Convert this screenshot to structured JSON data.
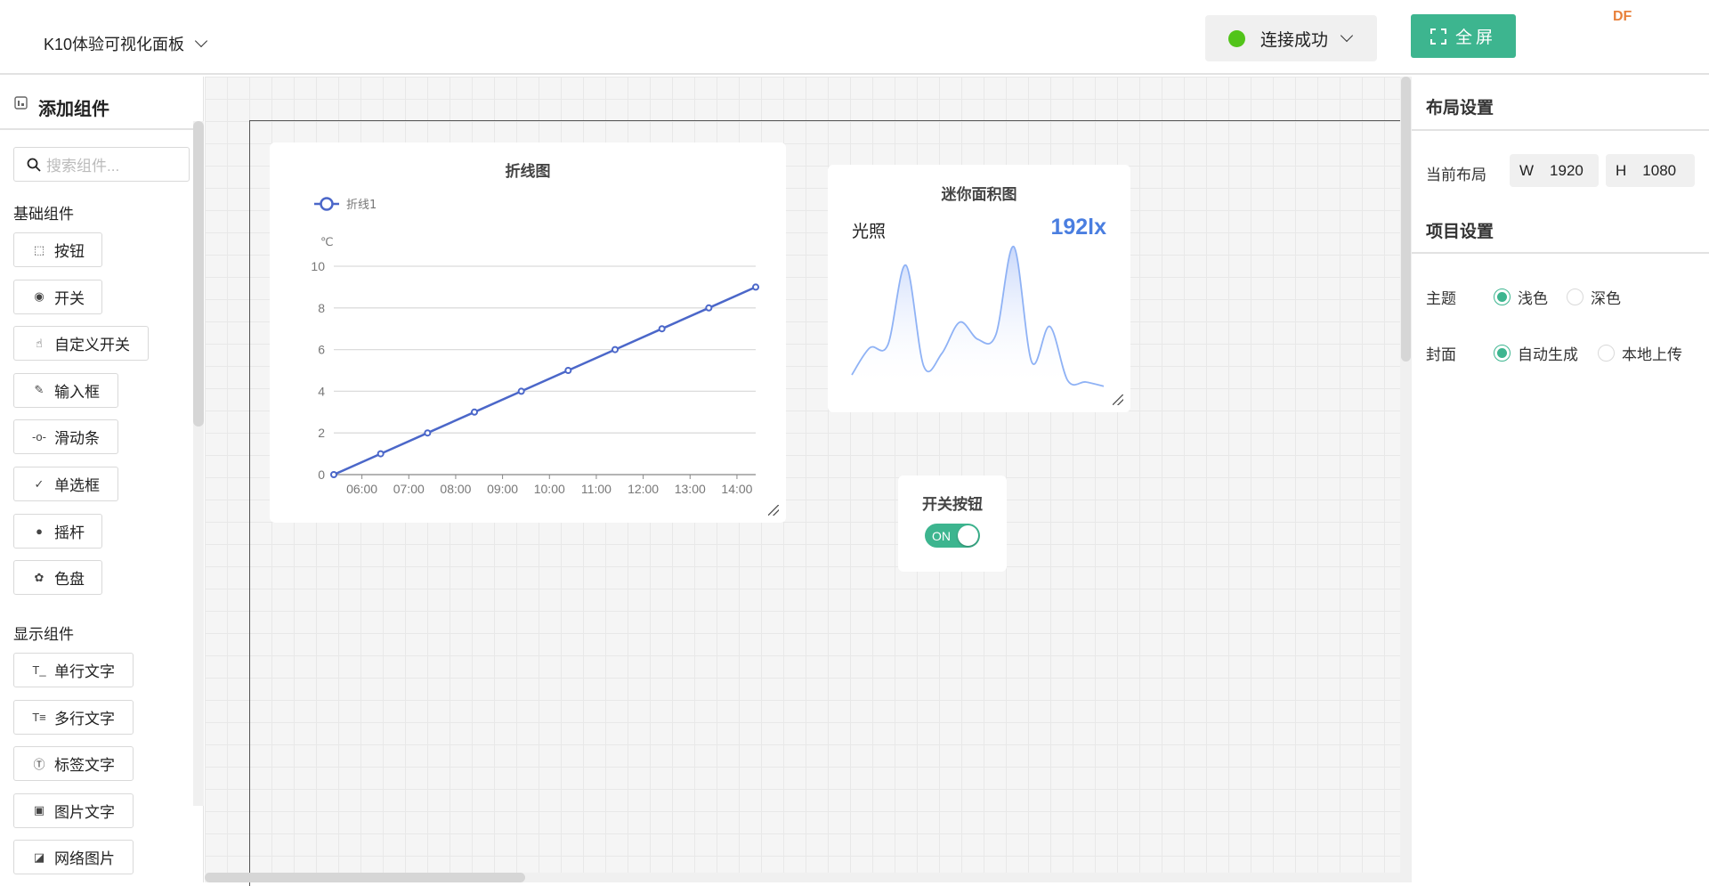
{
  "header": {
    "title": "K10体验可视化面板",
    "connection_label": "连接成功",
    "connection_color": "#52c41a",
    "fullscreen_label": "全屏",
    "badge": "DF",
    "accent": "#3db58f"
  },
  "sidebar": {
    "title": "添加组件",
    "search_placeholder": "搜索组件...",
    "sections": [
      {
        "label": "基础组件",
        "items": [
          {
            "label": "按钮",
            "icon": "cursor-click-icon"
          },
          {
            "label": "开关",
            "icon": "toggle-icon"
          },
          {
            "label": "自定义开关",
            "icon": "hand-pointer-icon"
          },
          {
            "label": "输入框",
            "icon": "edit-box-icon"
          },
          {
            "label": "滑动条",
            "icon": "slider-icon"
          },
          {
            "label": "单选框",
            "icon": "check-circle-icon"
          },
          {
            "label": "摇杆",
            "icon": "joystick-icon"
          },
          {
            "label": "色盘",
            "icon": "palette-icon"
          }
        ]
      },
      {
        "label": "显示组件",
        "items": [
          {
            "label": "单行文字",
            "icon": "single-line-text-icon"
          },
          {
            "label": "多行文字",
            "icon": "multi-line-text-icon"
          },
          {
            "label": "标签文字",
            "icon": "label-text-icon"
          },
          {
            "label": "图片文字",
            "icon": "image-text-icon"
          },
          {
            "label": "网络图片",
            "icon": "web-image-icon"
          }
        ]
      }
    ]
  },
  "widgets": {
    "line_chart": {
      "title": "折线图"
    },
    "mini_area": {
      "title": "迷你面积图",
      "label": "光照",
      "value": "192lx",
      "value_color": "#4a7ee0"
    },
    "switch": {
      "title": "开关按钮",
      "state_label": "ON",
      "on": true
    }
  },
  "right_panel": {
    "layout_title": "布局设置",
    "current_layout_label": "当前布局",
    "width_prefix": "W",
    "width": "1920",
    "height_prefix": "H",
    "height": "1080",
    "project_title": "项目设置",
    "theme_label": "主题",
    "theme_options": [
      "浅色",
      "深色"
    ],
    "theme_selected": 0,
    "cover_label": "封面",
    "cover_options": [
      "自动生成",
      "本地上传"
    ],
    "cover_selected": 0
  },
  "chart_data": [
    {
      "type": "line",
      "title": "折线图",
      "ylabel": "℃",
      "xlabel": "",
      "x": [
        "05:24",
        "06:24",
        "07:24",
        "08:24",
        "09:24",
        "10:24",
        "11:24",
        "12:24",
        "13:24",
        "14:24"
      ],
      "series": [
        {
          "name": "折线1",
          "values": [
            0,
            1,
            2,
            3,
            4,
            5,
            6,
            7,
            8,
            9
          ],
          "color": "#4b67c9"
        }
      ],
      "xticks": [
        "06:00",
        "07:00",
        "08:00",
        "09:00",
        "10:00",
        "11:00",
        "12:00",
        "13:00",
        "14:00"
      ],
      "yticks": [
        0,
        2,
        4,
        6,
        8,
        10
      ],
      "ylim": [
        0,
        10
      ],
      "xlim": [
        "05:24",
        "14:24"
      ],
      "grid": true,
      "legend": "top-left"
    },
    {
      "type": "area",
      "title": "迷你面积图",
      "values": [
        10,
        29,
        31,
        87,
        16,
        25,
        47,
        35,
        38,
        100,
        19,
        44,
        6,
        5,
        2
      ],
      "color": "#8fb2f5",
      "axes": false
    }
  ]
}
